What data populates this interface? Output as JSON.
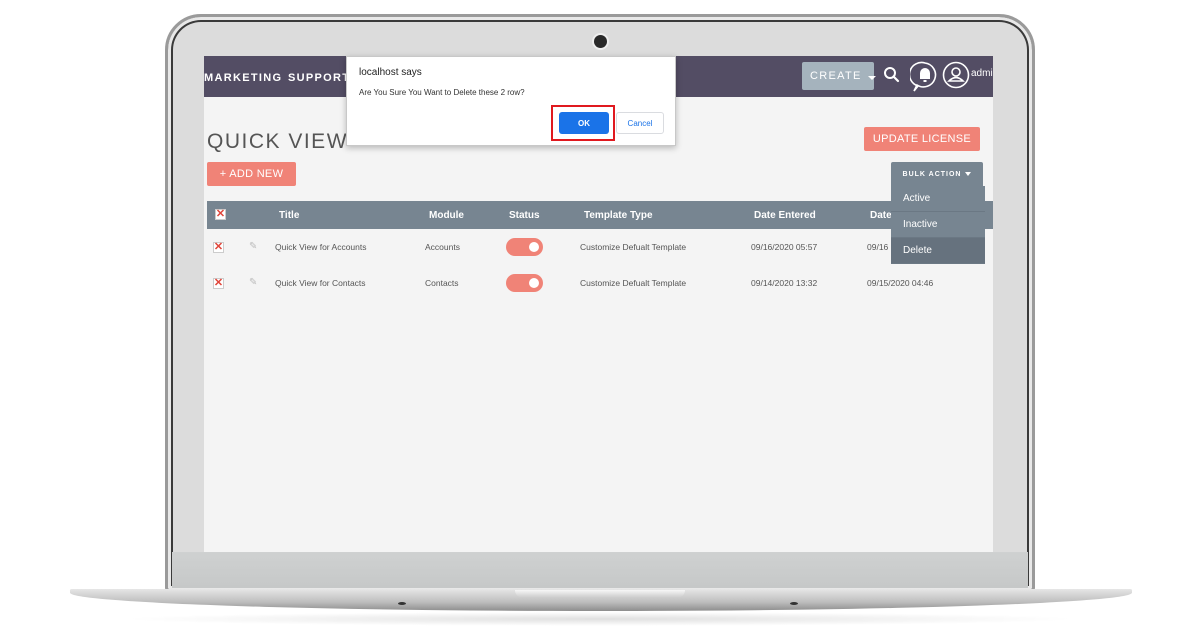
{
  "nav": {
    "items": [
      "MARKETING",
      "SUPPORT"
    ],
    "create_label": "CREATE",
    "user_label": "admi"
  },
  "page": {
    "title": "QUICK VIEW",
    "add_new_label": "+ ADD NEW",
    "update_license_label": "UPDATE LICENSE",
    "bulk_action_label": "BULK ACTION",
    "bulk_menu": [
      "Active",
      "Inactive",
      "Delete"
    ]
  },
  "table": {
    "columns": [
      "Title",
      "Module",
      "Status",
      "Template Type",
      "Date Entered",
      "Date"
    ],
    "rows": [
      {
        "title": "Quick View for Accounts",
        "module": "Accounts",
        "status": "on",
        "template_type": "Customize Defualt Template",
        "date_entered": "09/16/2020 05:57",
        "date_modified": "09/16"
      },
      {
        "title": "Quick View for Contacts",
        "module": "Contacts",
        "status": "on",
        "template_type": "Customize Defualt Template",
        "date_entered": "09/14/2020 13:32",
        "date_modified": "09/15/2020 04:46"
      }
    ]
  },
  "dialog": {
    "title": "localhost says",
    "message": "Are You Sure You Want to Delete these 2 row?",
    "ok_label": "OK",
    "cancel_label": "Cancel"
  },
  "colors": {
    "nav_bg": "#534d64",
    "accent": "#f08377",
    "header_bg": "#778591",
    "dialog_primary": "#1a73e8",
    "highlight": "#e0191f"
  }
}
